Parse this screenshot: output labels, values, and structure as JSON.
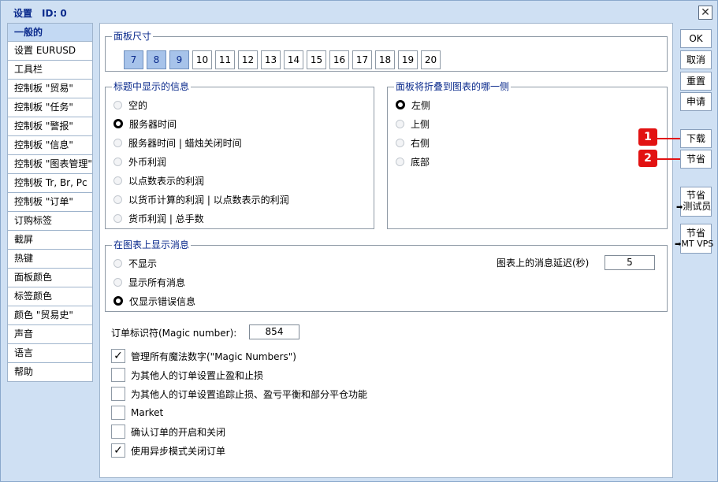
{
  "window": {
    "title": "设置",
    "id_label": "ID: 0",
    "close_glyph": "✕"
  },
  "nav": {
    "items": [
      {
        "label": "一般的"
      },
      {
        "label": "设置 EURUSD"
      },
      {
        "label": "工具栏"
      },
      {
        "label": "控制板 \"贸易\""
      },
      {
        "label": "控制板 \"任务\""
      },
      {
        "label": "控制板 \"警报\""
      },
      {
        "label": "控制板 \"信息\""
      },
      {
        "label": "控制板 \"图表管理\""
      },
      {
        "label": "控制板 Tr, Br, Pc"
      },
      {
        "label": "控制板 \"订单\""
      },
      {
        "label": "订购标签"
      },
      {
        "label": "截屏"
      },
      {
        "label": "热键"
      },
      {
        "label": "面板颜色"
      },
      {
        "label": "标签颜色"
      },
      {
        "label": "颜色 \"贸易史\""
      },
      {
        "label": "声音"
      },
      {
        "label": "语言"
      },
      {
        "label": "帮助"
      }
    ],
    "active_index": 0
  },
  "panel_size": {
    "title": "面板尺寸",
    "sizes": [
      "7",
      "8",
      "9",
      "10",
      "11",
      "12",
      "13",
      "14",
      "15",
      "16",
      "17",
      "18",
      "19",
      "20"
    ],
    "selected": [
      "7",
      "8",
      "9"
    ]
  },
  "title_info": {
    "title": "标题中显示的信息",
    "options": [
      {
        "label": "空的"
      },
      {
        "label": "服务器时间"
      },
      {
        "label": "服务器时间 | 蜡烛关闭时间"
      },
      {
        "label": "外币利润"
      },
      {
        "label": "以点数表示的利润"
      },
      {
        "label": "以货币计算的利润 | 以点数表示的利润"
      },
      {
        "label": "货币利润 | 总手数"
      }
    ],
    "selected_index": 1
  },
  "fold_side": {
    "title": "面板将折叠到图表的哪一侧",
    "options": [
      {
        "label": "左侧"
      },
      {
        "label": "上侧"
      },
      {
        "label": "右侧"
      },
      {
        "label": "底部"
      }
    ],
    "selected_index": 0
  },
  "chart_messages": {
    "title": "在图表上显示消息",
    "options": [
      {
        "label": "不显示"
      },
      {
        "label": "显示所有消息"
      },
      {
        "label": "仅显示错误信息"
      }
    ],
    "selected_index": 2,
    "delay_label": "图表上的消息延迟(秒)",
    "delay_value": "5"
  },
  "magic": {
    "label": "订单标识符(Magic number):",
    "value": "854"
  },
  "checkboxes": [
    {
      "label": "管理所有魔法数字(\"Magic Numbers\")",
      "checked": true
    },
    {
      "label": "为其他人的订单设置止盈和止损",
      "checked": false
    },
    {
      "label": "为其他人的订单设置追踪止损、盈亏平衡和部分平仓功能",
      "checked": false
    },
    {
      "label": "Market",
      "checked": false
    },
    {
      "label": "确认订单的开启和关闭",
      "checked": false
    },
    {
      "label": "使用异步模式关闭订单",
      "checked": true
    }
  ],
  "check_glyph": "✓",
  "buttons": {
    "ok": "OK",
    "cancel": "取消",
    "reset": "重置",
    "apply": "申请",
    "download": "下载",
    "save": "节省",
    "save_tester_1": "节省",
    "save_tester_2": "测试员",
    "save_vps_1": "节省",
    "save_vps_2": "MT VPS",
    "arrow_glyph": "➡"
  },
  "markers": [
    "1",
    "2"
  ],
  "colors": {
    "accent": "#0a2a8c",
    "window_bg": "#cfe0f3",
    "selected": "#a7c3ea",
    "marker": "#e21212"
  }
}
